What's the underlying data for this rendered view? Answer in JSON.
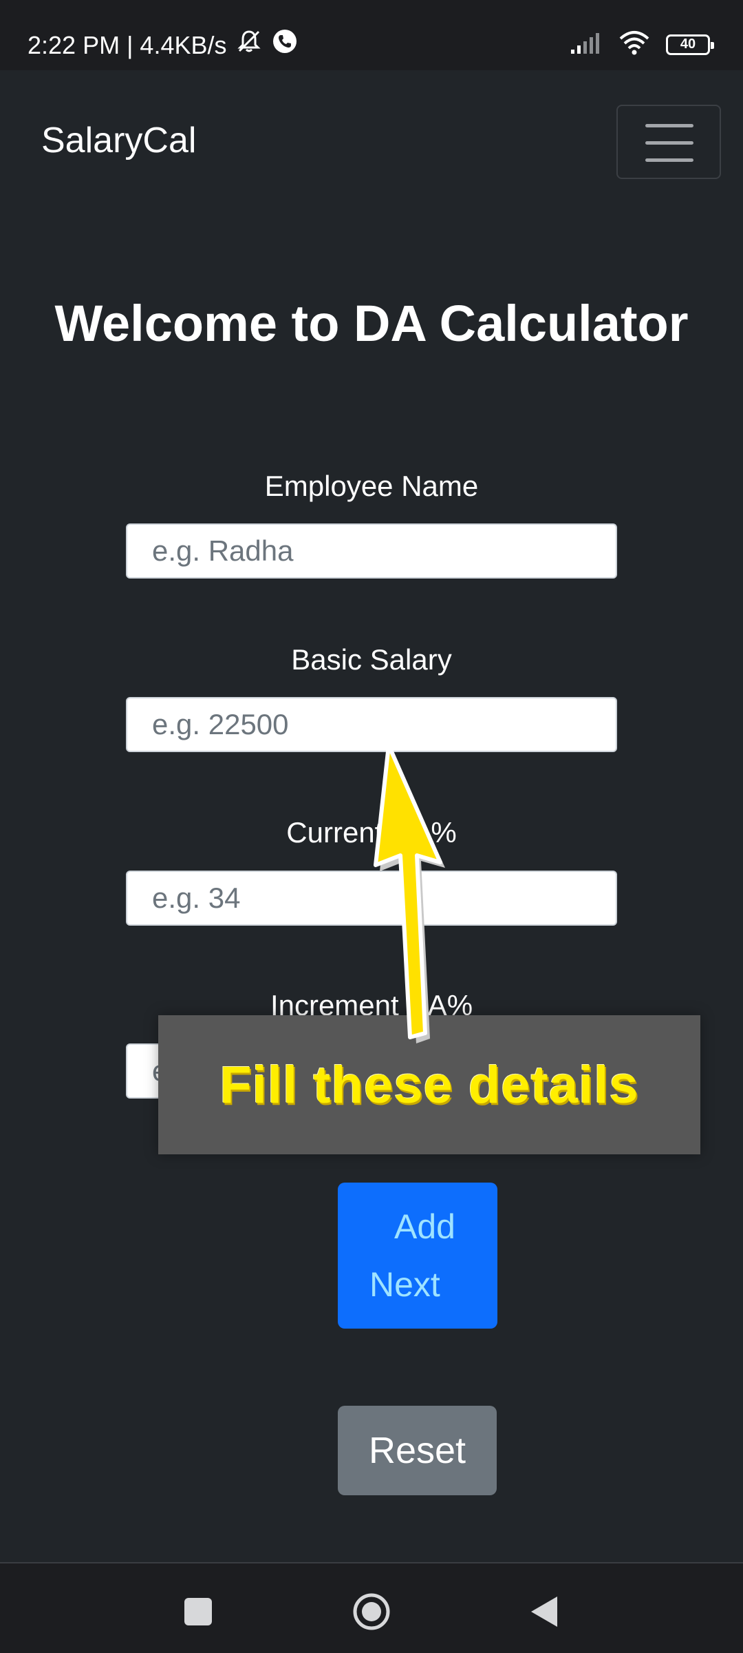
{
  "status_bar": {
    "time_speed": "2:22 PM | 4.4KB/s",
    "battery": "40"
  },
  "navbar": {
    "brand": "SalaryCal"
  },
  "main": {
    "title": "Welcome to DA Calculator",
    "fields": [
      {
        "label": "Employee Name",
        "placeholder": "e.g. Radha"
      },
      {
        "label": "Basic Salary",
        "placeholder": "e.g. 22500"
      },
      {
        "label": "Current DA%",
        "placeholder": "e.g. 34"
      },
      {
        "label": "Increment DA%",
        "placeholder": "e.g. 38"
      }
    ],
    "add_button": {
      "line1": "Add",
      "line2": "Next"
    },
    "reset_button": "Reset"
  },
  "overlay": {
    "text": "Fill these details"
  },
  "colors": {
    "background": "#212529",
    "primary": "#0d6efd",
    "secondary": "#6c757d",
    "highlight": "#ffee00"
  },
  "icons": [
    "silent-mode-icon",
    "call-icon",
    "signal-icon",
    "wifi-icon",
    "battery-icon",
    "hamburger-menu-icon",
    "square-icon",
    "home-circle-icon",
    "back-triangle-icon",
    "arrow-pointer-icon"
  ]
}
